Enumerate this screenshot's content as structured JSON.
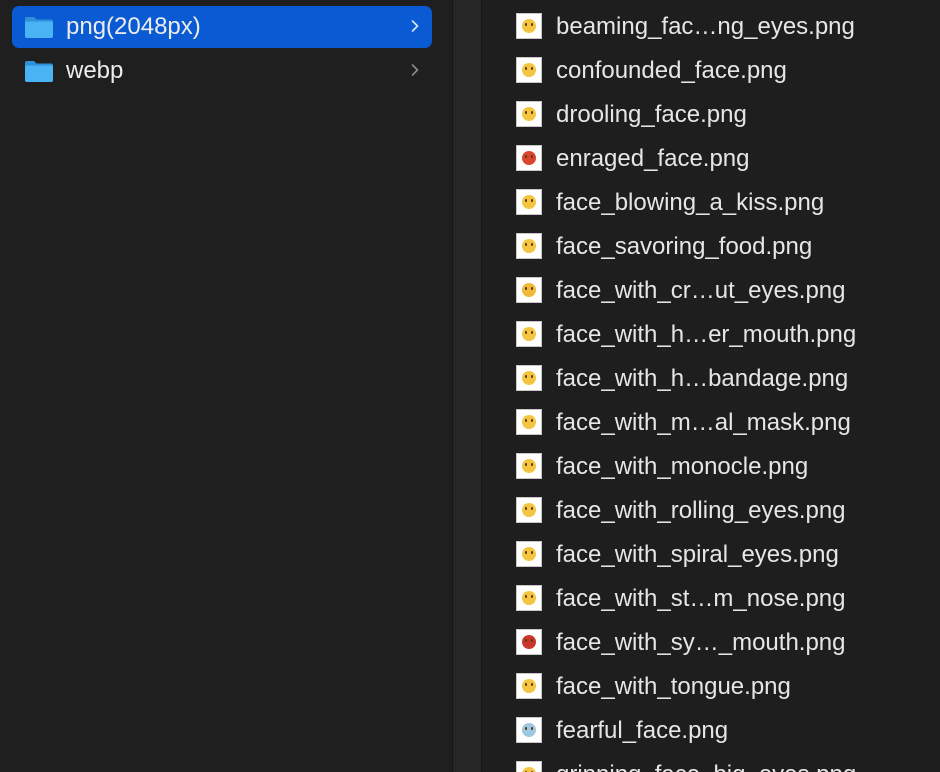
{
  "folders": [
    {
      "label": "png(2048px)",
      "selected": true
    },
    {
      "label": "webp",
      "selected": false
    }
  ],
  "colors": {
    "selection": "#0a5bd3",
    "folder_icon": "#3aa7ee",
    "text": "#e6e6e6",
    "background": "#1e1e1e"
  },
  "files": [
    {
      "name": "beaming_fac…ng_eyes.png",
      "icon": "beaming-face-thumbnail-icon",
      "color": "#f5c542"
    },
    {
      "name": "confounded_face.png",
      "icon": "confounded-face-thumbnail-icon",
      "color": "#f5c542"
    },
    {
      "name": "drooling_face.png",
      "icon": "drooling-face-thumbnail-icon",
      "color": "#f5c542"
    },
    {
      "name": "enraged_face.png",
      "icon": "enraged-face-thumbnail-icon",
      "color": "#d9452f"
    },
    {
      "name": "face_blowing_a_kiss.png",
      "icon": "kiss-face-thumbnail-icon",
      "color": "#f5c542"
    },
    {
      "name": "face_savoring_food.png",
      "icon": "savoring-face-thumbnail-icon",
      "color": "#f5c542"
    },
    {
      "name": "face_with_cr…ut_eyes.png",
      "icon": "crossed-eyes-face-thumbnail-icon",
      "color": "#f0b93a"
    },
    {
      "name": "face_with_h…er_mouth.png",
      "icon": "hand-over-mouth-face-thumbnail-icon",
      "color": "#f5c542"
    },
    {
      "name": "face_with_h…bandage.png",
      "icon": "head-bandage-face-thumbnail-icon",
      "color": "#f5c542"
    },
    {
      "name": "face_with_m…al_mask.png",
      "icon": "medical-mask-face-thumbnail-icon",
      "color": "#f5c542"
    },
    {
      "name": "face_with_monocle.png",
      "icon": "monocle-face-thumbnail-icon",
      "color": "#f5c542"
    },
    {
      "name": "face_with_rolling_eyes.png",
      "icon": "rolling-eyes-face-thumbnail-icon",
      "color": "#f5c542"
    },
    {
      "name": "face_with_spiral_eyes.png",
      "icon": "spiral-eyes-face-thumbnail-icon",
      "color": "#f5c542"
    },
    {
      "name": "face_with_st…m_nose.png",
      "icon": "steam-nose-face-thumbnail-icon",
      "color": "#f5c542"
    },
    {
      "name": "face_with_sy…_mouth.png",
      "icon": "symbols-mouth-face-thumbnail-icon",
      "color": "#c9362b"
    },
    {
      "name": "face_with_tongue.png",
      "icon": "tongue-face-thumbnail-icon",
      "color": "#f5c542"
    },
    {
      "name": "fearful_face.png",
      "icon": "fearful-face-thumbnail-icon",
      "color": "#9ec8e0"
    },
    {
      "name": "grinning_face_big_eyes.png",
      "icon": "grinning-face-thumbnail-icon",
      "color": "#f5c542"
    }
  ]
}
